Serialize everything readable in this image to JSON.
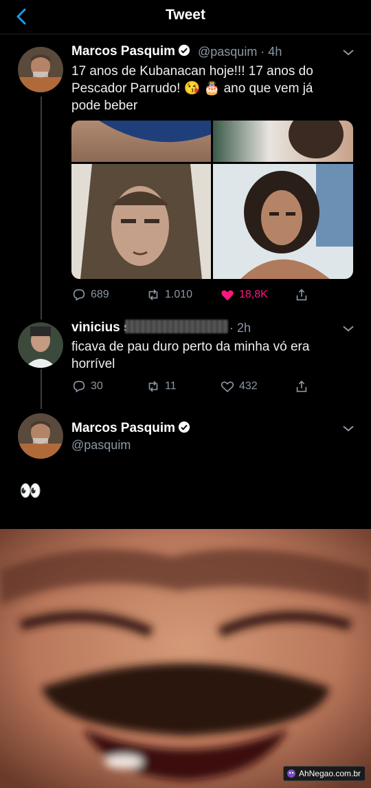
{
  "header": {
    "title": "Tweet"
  },
  "tweet1": {
    "name": "Marcos Pasquim",
    "handle_time": "@pasquim · 4h",
    "lines": [
      "17 anos de Kubanacan hoje!!! 17 anos do",
      "Pescador Parrudo! 😘 🎂 ano que vem já",
      "pode beber"
    ],
    "replies": "689",
    "retweets": "1.010",
    "likes": "18,8K"
  },
  "reply": {
    "name": "vinicius s",
    "time": "· 2h",
    "lines": [
      "ficava de pau duro perto da minha vó era",
      "horrível"
    ],
    "replies": "30",
    "retweets": "11",
    "likes": "432"
  },
  "tweet2": {
    "name": "Marcos Pasquim",
    "handle": "@pasquim",
    "text": "👀"
  },
  "watermark": {
    "text": "AhNegao.com.br"
  },
  "colors": {
    "like": "#f91880",
    "link": "#1d9bf0",
    "muted": "#8b98a5"
  }
}
